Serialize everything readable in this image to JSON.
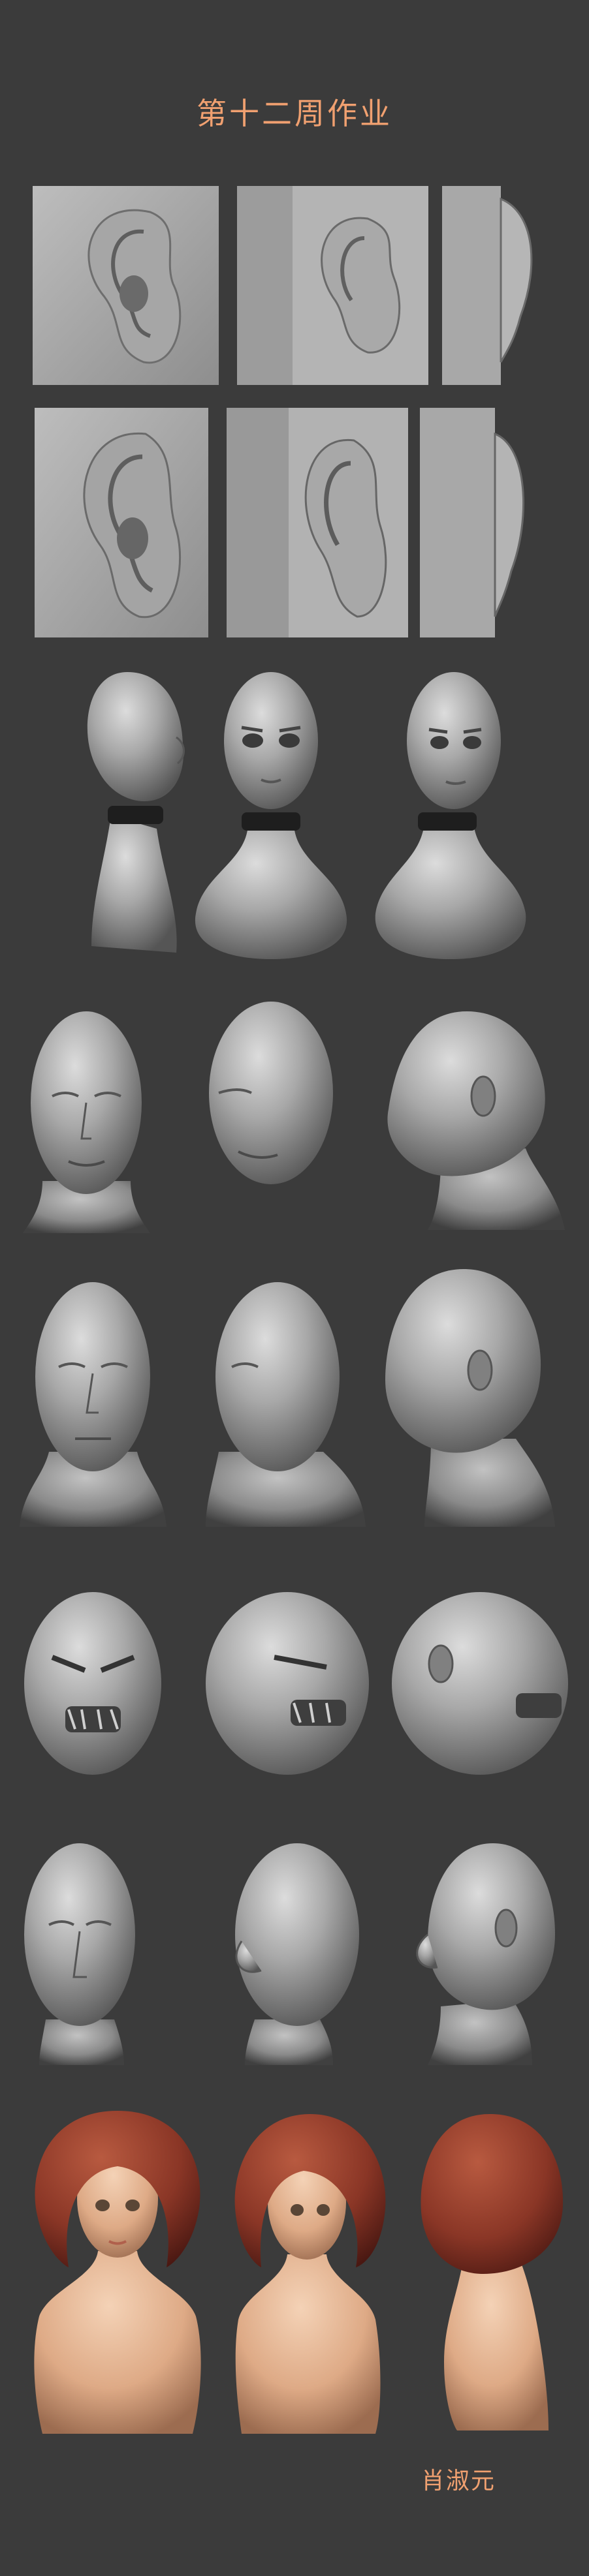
{
  "page": {
    "title": "第十二周作业",
    "author_signature": "肖淑元"
  },
  "colors": {
    "background": "#3b3b3b",
    "accent_text": "#f0a070",
    "clay": "#9a9a9a",
    "skin": "#e2b08f",
    "hair": "#8e3a2a"
  },
  "rows": [
    {
      "subject": "ear-study-1",
      "views": [
        "front",
        "three-quarter",
        "side"
      ]
    },
    {
      "subject": "ear-study-2",
      "views": [
        "front",
        "three-quarter",
        "side"
      ]
    },
    {
      "subject": "female-bust",
      "views": [
        "side",
        "front",
        "three-quarter"
      ]
    },
    {
      "subject": "old-man-head",
      "views": [
        "front",
        "three-quarter",
        "side"
      ]
    },
    {
      "subject": "man-bust",
      "views": [
        "front",
        "three-quarter",
        "side"
      ]
    },
    {
      "subject": "ogre-head",
      "views": [
        "front",
        "three-quarter",
        "side"
      ]
    },
    {
      "subject": "elderly-head",
      "views": [
        "front",
        "three-quarter",
        "side"
      ]
    },
    {
      "subject": "painted-girl-bust",
      "views": [
        "front",
        "three-quarter",
        "side"
      ]
    }
  ]
}
